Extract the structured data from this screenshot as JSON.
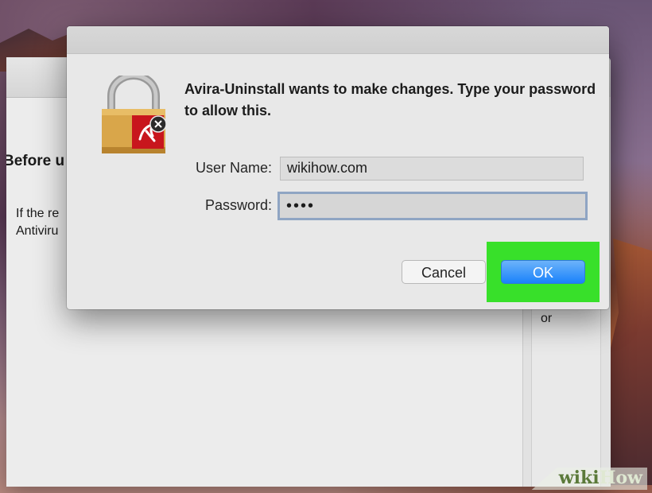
{
  "background_window": {
    "heading": "Before u",
    "body": "If the re\nAntiviru",
    "right_text": "or"
  },
  "dialog": {
    "message": "Avira-Uninstall wants to make changes. Type your password to allow this.",
    "username_label": "User Name:",
    "username_value": "wikihow.com",
    "password_label": "Password:",
    "password_value": "••••",
    "cancel_label": "Cancel",
    "ok_label": "OK"
  },
  "watermark": {
    "part1": "wiki",
    "part2": "How"
  },
  "colors": {
    "highlight": "#38e02a",
    "ok_button": "#1a82fb",
    "lock_body": "#d9a64a",
    "badge_red": "#c8161d"
  },
  "icons": {
    "lock": "lock-icon",
    "badge": "avira-umbrella-icon",
    "close_badge": "close-badge-icon"
  }
}
